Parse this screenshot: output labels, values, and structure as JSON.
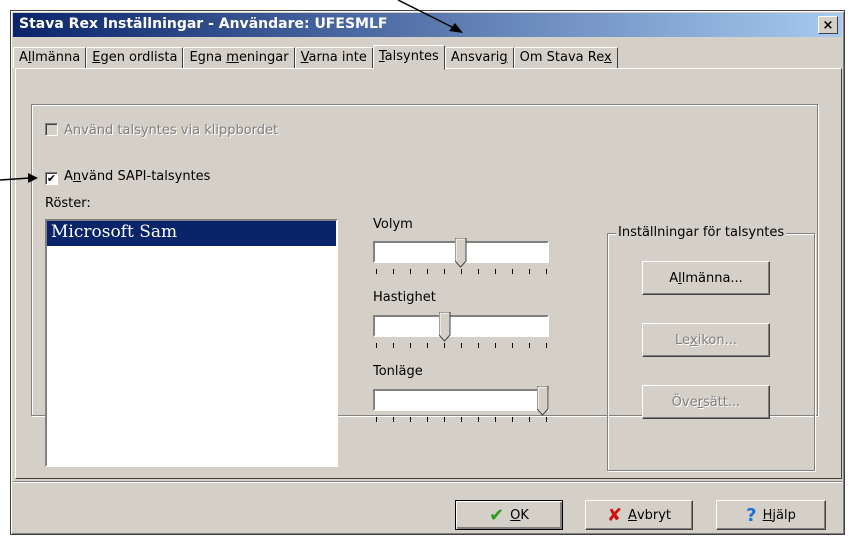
{
  "window": {
    "title": "Stava Rex Inställningar - Användare: UFESMLF",
    "close_glyph": "×"
  },
  "tabs": [
    {
      "label": "Allmänna",
      "accel": "l",
      "pre": "A",
      "post": "lmänna"
    },
    {
      "label": "Egen ordlista",
      "pre": "",
      "accel": "E",
      "post": "gen ordlista"
    },
    {
      "label": "Egna meningar",
      "pre": "Egna ",
      "accel": "m",
      "post": "eningar"
    },
    {
      "label": "Varna inte",
      "pre": "",
      "accel": "V",
      "post": "arna inte"
    },
    {
      "label": "Talsyntes",
      "pre": "",
      "accel": "T",
      "post": "alsyntes"
    },
    {
      "label": "Ansvarig",
      "pre": "Ansvari",
      "accel": "g",
      "post": ""
    },
    {
      "label": "Om Stava Rex",
      "pre": "Om Stava Re",
      "accel": "x",
      "post": ""
    }
  ],
  "clipboard_option": {
    "label": "Använd talsyntes via klippbordet",
    "checked": false,
    "enabled": false
  },
  "sapi_option": {
    "pre": "A",
    "accel": "n",
    "post": "vänd SAPI-talsyntes",
    "checked": true,
    "check_glyph": "✔"
  },
  "voices": {
    "label": "Röster:",
    "items": [
      "Microsoft Sam"
    ],
    "selected": 0
  },
  "sliders": [
    {
      "label": "Volym",
      "level": 0.5
    },
    {
      "label": "Hastighet",
      "level": 0.4
    },
    {
      "label": "Tonläge",
      "level": 1.0
    }
  ],
  "settings_group": {
    "legend": "Inställningar för talsyntes",
    "general": {
      "pre": "A",
      "accel": "l",
      "post": "lmänna..."
    },
    "lexicon": {
      "pre": "Le",
      "accel": "x",
      "post": "ikon..."
    },
    "translate": {
      "pre": "Öve",
      "accel": "r",
      "post": "sätt..."
    }
  },
  "footer": {
    "ok": {
      "accel": "O",
      "post": "K",
      "icon": "✔",
      "icon_color": "#2e9a1f"
    },
    "cancel": {
      "accel": "A",
      "post": "vbryt",
      "icon": "✘",
      "icon_color": "#d01010"
    },
    "help": {
      "accel": "H",
      "post": "jälp",
      "icon": "?",
      "icon_color": "#1f6fd6"
    }
  }
}
